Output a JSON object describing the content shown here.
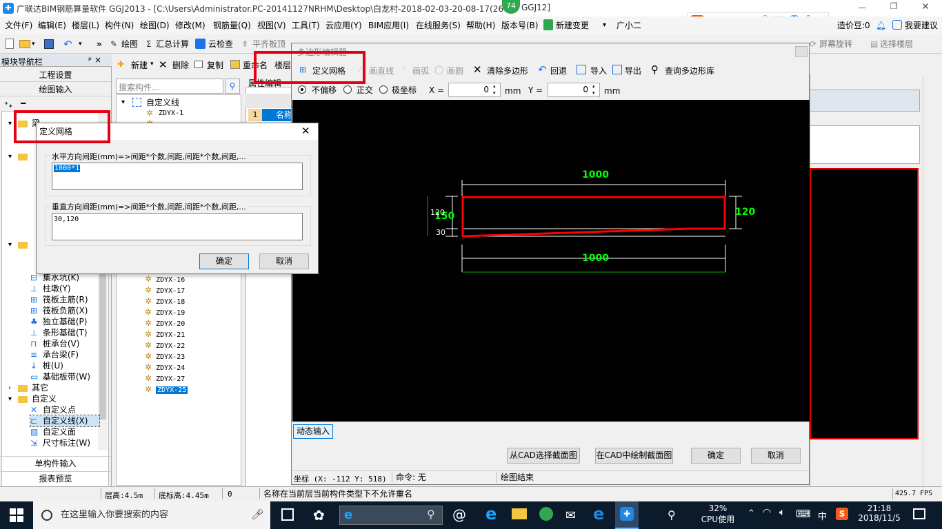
{
  "window_title": "广联达BIM钢筋算量软件 GGJ2013 - [C:\\Users\\Administrator.PC-20141127NRHM\\Desktop\\白龙村-2018-02-03-20-08-17(26",
  "window_title_tail": "GGJ12]",
  "badge_count": "74",
  "ime": {
    "lang": "中",
    "punct": "°,"
  },
  "account": {
    "price_label": "造价豆:0",
    "suggest": "我要建议"
  },
  "menu": [
    "文件(F)",
    "编辑(E)",
    "楼层(L)",
    "构件(N)",
    "绘图(D)",
    "修改(M)",
    "钢筋量(Q)",
    "视图(V)",
    "工具(T)",
    "云应用(Y)",
    "BIM应用(I)",
    "在线服务(S)",
    "帮助(H)",
    "版本号(B)",
    "新建变更",
    "广小二"
  ],
  "toolbar": {
    "draw": "绘图",
    "sum": "汇总计算",
    "cloud_check": "云检查",
    "align_top": "平齐板顶",
    "rotate": "屏幕旋转",
    "select_floor": "选择楼层"
  },
  "nav": {
    "title": "模块导航栏",
    "pin": "ᵖ ×",
    "project_settings": "工程设置",
    "draw_input": "绘图输入",
    "single_input": "单构件输入",
    "report_preview": "报表预览"
  },
  "nav_tree": {
    "beam": "梁",
    "items_foundation": [
      "集水坑(K)",
      "柱墩(Y)",
      "筏板主筋(R)",
      "筏板负筋(X)",
      "独立基础(P)",
      "条形基础(T)",
      "桩承台(V)",
      "承台梁(F)",
      "桩(U)",
      "基础板带(W)"
    ],
    "other": "其它",
    "custom": "自定义",
    "items_custom": [
      "自定义点",
      "自定义线(X)",
      "自定义面",
      "尺寸标注(W)"
    ]
  },
  "comp_panel": {
    "new": "新建",
    "delete": "删除",
    "copy": "复制",
    "rename": "重命名",
    "floor": "楼层",
    "search_placeholder": "搜索构件...",
    "root": "自定义线",
    "first": "ZDYX-1",
    "items": [
      "ZDYX-16",
      "ZDYX-17",
      "ZDYX-18",
      "ZDYX-19",
      "ZDYX-20",
      "ZDYX-21",
      "ZDYX-22",
      "ZDYX-23",
      "ZDYX-24",
      "ZDYX-27",
      "ZDYX-25"
    ]
  },
  "prop_panel": {
    "header": "属性编辑",
    "row1_num": "1",
    "row1_name": "名称"
  },
  "poly_editor": {
    "title": "多边形编辑器",
    "tools": {
      "define_grid": "定义网格",
      "draw_line": "画直线",
      "draw_arc": "画弧",
      "draw_circle": "画圆",
      "clear": "清除多边形",
      "undo": "回退",
      "import": "导入",
      "export": "导出",
      "query": "查询多边形库"
    },
    "coords": {
      "no_offset": "不偏移",
      "ortho": "正交",
      "polar": "极坐标",
      "x_label": "X =",
      "x_value": "0",
      "y_label": "Y =",
      "y_value": "0",
      "unit": "mm"
    },
    "canvas": {
      "dim_top": "1000",
      "dim_bottom": "1000",
      "dim_right": "120",
      "dim_left_big": "150",
      "dim_left_120": "120",
      "dim_left_30": "30"
    },
    "dynamic_input": "动态输入",
    "buttons": {
      "from_cad": "从CAD选择截面图",
      "draw_in_cad": "在CAD中绘制截面图",
      "ok": "确定",
      "cancel": "取消"
    },
    "status": {
      "coord": "坐标 (X: -112 Y: 518)",
      "cmd": "命令: 无",
      "draw_end": "绘图结束"
    }
  },
  "grid_dialog": {
    "title": "定义网格",
    "h_label": "水平方向间距(mm)=>间距*个数,间距,间距*个数,间距,...",
    "h_value": "1000*1",
    "v_label": "垂直方向间距(mm)=>间距*个数,间距,间距*个数,间距,...",
    "v_value": "30,120",
    "ok": "确定",
    "cancel": "取消"
  },
  "statusbar": {
    "floor_h": "层高:4.5m",
    "base_h": "底标高:4.45m",
    "zero": "0",
    "message": "名称在当前层当前构件类型下不允许重名",
    "fps": "425.7 FPS"
  },
  "taskbar": {
    "search_placeholder": "在这里输入你要搜索的内容",
    "cpu_pct": "32%",
    "cpu_label": "CPU使用",
    "ime": "中",
    "time": "21:18",
    "date": "2018/11/5"
  },
  "colors": {
    "accent": "#0078d7",
    "red_highlight": "#e60012",
    "canvas": "#000000",
    "dim_green": "#00ff00",
    "poly_red": "#ff0000"
  }
}
